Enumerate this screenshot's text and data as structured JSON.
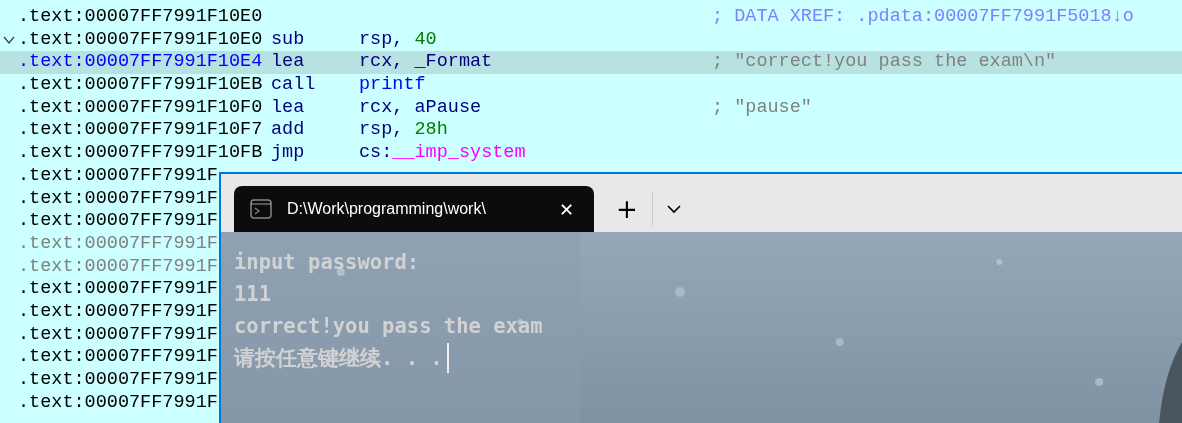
{
  "listing": {
    "rows": [
      {
        "address": ".text:00007FF7991F10E0",
        "selected": false,
        "dimmed": false,
        "comment": {
          "text": "; DATA XREF: .pdata:00007FF7991F5018↓o",
          "kind": "xref"
        }
      },
      {
        "address": ".text:00007FF7991F10E0",
        "selected": false,
        "dimmed": false,
        "expanded": true,
        "mnemonic": "sub",
        "operands": [
          {
            "text": "rsp, ",
            "kind": "register"
          },
          {
            "text": "40",
            "kind": "number"
          }
        ]
      },
      {
        "address": ".text:00007FF7991F10E4",
        "selected": true,
        "dimmed": false,
        "mnemonic": "lea",
        "operands": [
          {
            "text": "rcx, _Format",
            "kind": "register"
          }
        ],
        "comment": {
          "text": "; \"correct!you pass the exam\\n\"",
          "kind": "string"
        }
      },
      {
        "address": ".text:00007FF7991F10EB",
        "selected": false,
        "dimmed": false,
        "mnemonic": "call",
        "operands": [
          {
            "text": "printf",
            "kind": "function"
          }
        ]
      },
      {
        "address": ".text:00007FF7991F10F0",
        "selected": false,
        "dimmed": false,
        "mnemonic": "lea",
        "operands": [
          {
            "text": "rcx, aPause",
            "kind": "register"
          }
        ],
        "comment": {
          "text": "; \"pause\"",
          "kind": "string"
        }
      },
      {
        "address": ".text:00007FF7991F10F7",
        "selected": false,
        "dimmed": false,
        "mnemonic": "add",
        "operands": [
          {
            "text": "rsp, ",
            "kind": "register"
          },
          {
            "text": "28h",
            "kind": "number"
          }
        ]
      },
      {
        "address": ".text:00007FF7991F10FB",
        "selected": false,
        "dimmed": false,
        "mnemonic": "jmp",
        "operands": [
          {
            "text": "cs:",
            "kind": "register"
          },
          {
            "text": "__imp_system",
            "kind": "import"
          }
        ]
      },
      {
        "address": ".text:00007FF7991F",
        "selected": false,
        "dimmed": false
      },
      {
        "address": ".text:00007FF7991F",
        "selected": false,
        "dimmed": false
      },
      {
        "address": ".text:00007FF7991F",
        "selected": false,
        "dimmed": false
      },
      {
        "address": ".text:00007FF7991F",
        "selected": false,
        "dimmed": true
      },
      {
        "address": ".text:00007FF7991F",
        "selected": false,
        "dimmed": true
      },
      {
        "address": ".text:00007FF7991F",
        "selected": false,
        "dimmed": false
      },
      {
        "address": ".text:00007FF7991F",
        "selected": false,
        "dimmed": false
      },
      {
        "address": ".text:00007FF7991F",
        "selected": false,
        "dimmed": false
      },
      {
        "address": ".text:00007FF7991F",
        "selected": false,
        "dimmed": false
      },
      {
        "address": ".text:00007FF7991F",
        "selected": false,
        "dimmed": false
      },
      {
        "address": ".text:00007FF7991F",
        "selected": false,
        "dimmed": false
      }
    ]
  },
  "terminal": {
    "tab": {
      "title": "D:\\Work\\programming\\work\\",
      "close": "✕"
    },
    "new_tab": "+",
    "lines": [
      {
        "text": "input password:",
        "cursor": false
      },
      {
        "text": "111",
        "cursor": false
      },
      {
        "text": "correct!you pass the exam",
        "cursor": false
      },
      {
        "text": "请按任意键继续. . .",
        "cursor": true
      }
    ]
  }
}
